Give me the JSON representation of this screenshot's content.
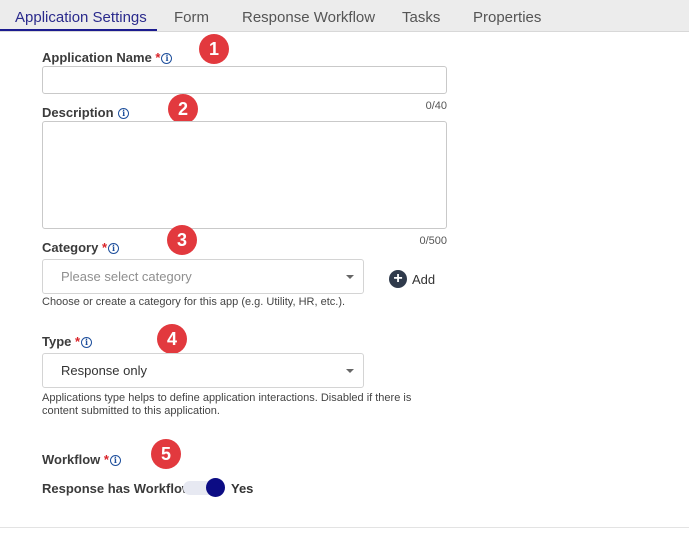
{
  "tabs": [
    {
      "label": "Application Settings",
      "active": true
    },
    {
      "label": "Form",
      "active": false
    },
    {
      "label": "Response Workflow",
      "active": false
    },
    {
      "label": "Tasks",
      "active": false
    },
    {
      "label": "Properties",
      "active": false
    }
  ],
  "markers": [
    "1",
    "2",
    "3",
    "4",
    "5"
  ],
  "info_glyph": "i",
  "required_mark": "*",
  "application_name": {
    "label": "Application Name",
    "value": "",
    "counter": "0/40"
  },
  "description": {
    "label": "Description",
    "value": "",
    "counter": "0/500"
  },
  "category": {
    "label": "Category",
    "placeholder": "Please select category",
    "hint": "Choose or create a category for this app (e.g. Utility, HR, etc.)."
  },
  "add_button": {
    "icon": "+",
    "label": "Add"
  },
  "type": {
    "label": "Type",
    "value": "Response only",
    "hint_line1": "Applications type helps to define application interactions. Disabled if there is",
    "hint_line2": "content submitted to this application."
  },
  "workflow": {
    "label": "Workflow",
    "toggle_label": "Response has Workflow",
    "toggle_state": true,
    "toggle_text": "Yes"
  },
  "colors": {
    "accent": "#1b1b8f",
    "required": "#d9242a",
    "marker": "#e2393e",
    "info": "#1e4f9c"
  }
}
